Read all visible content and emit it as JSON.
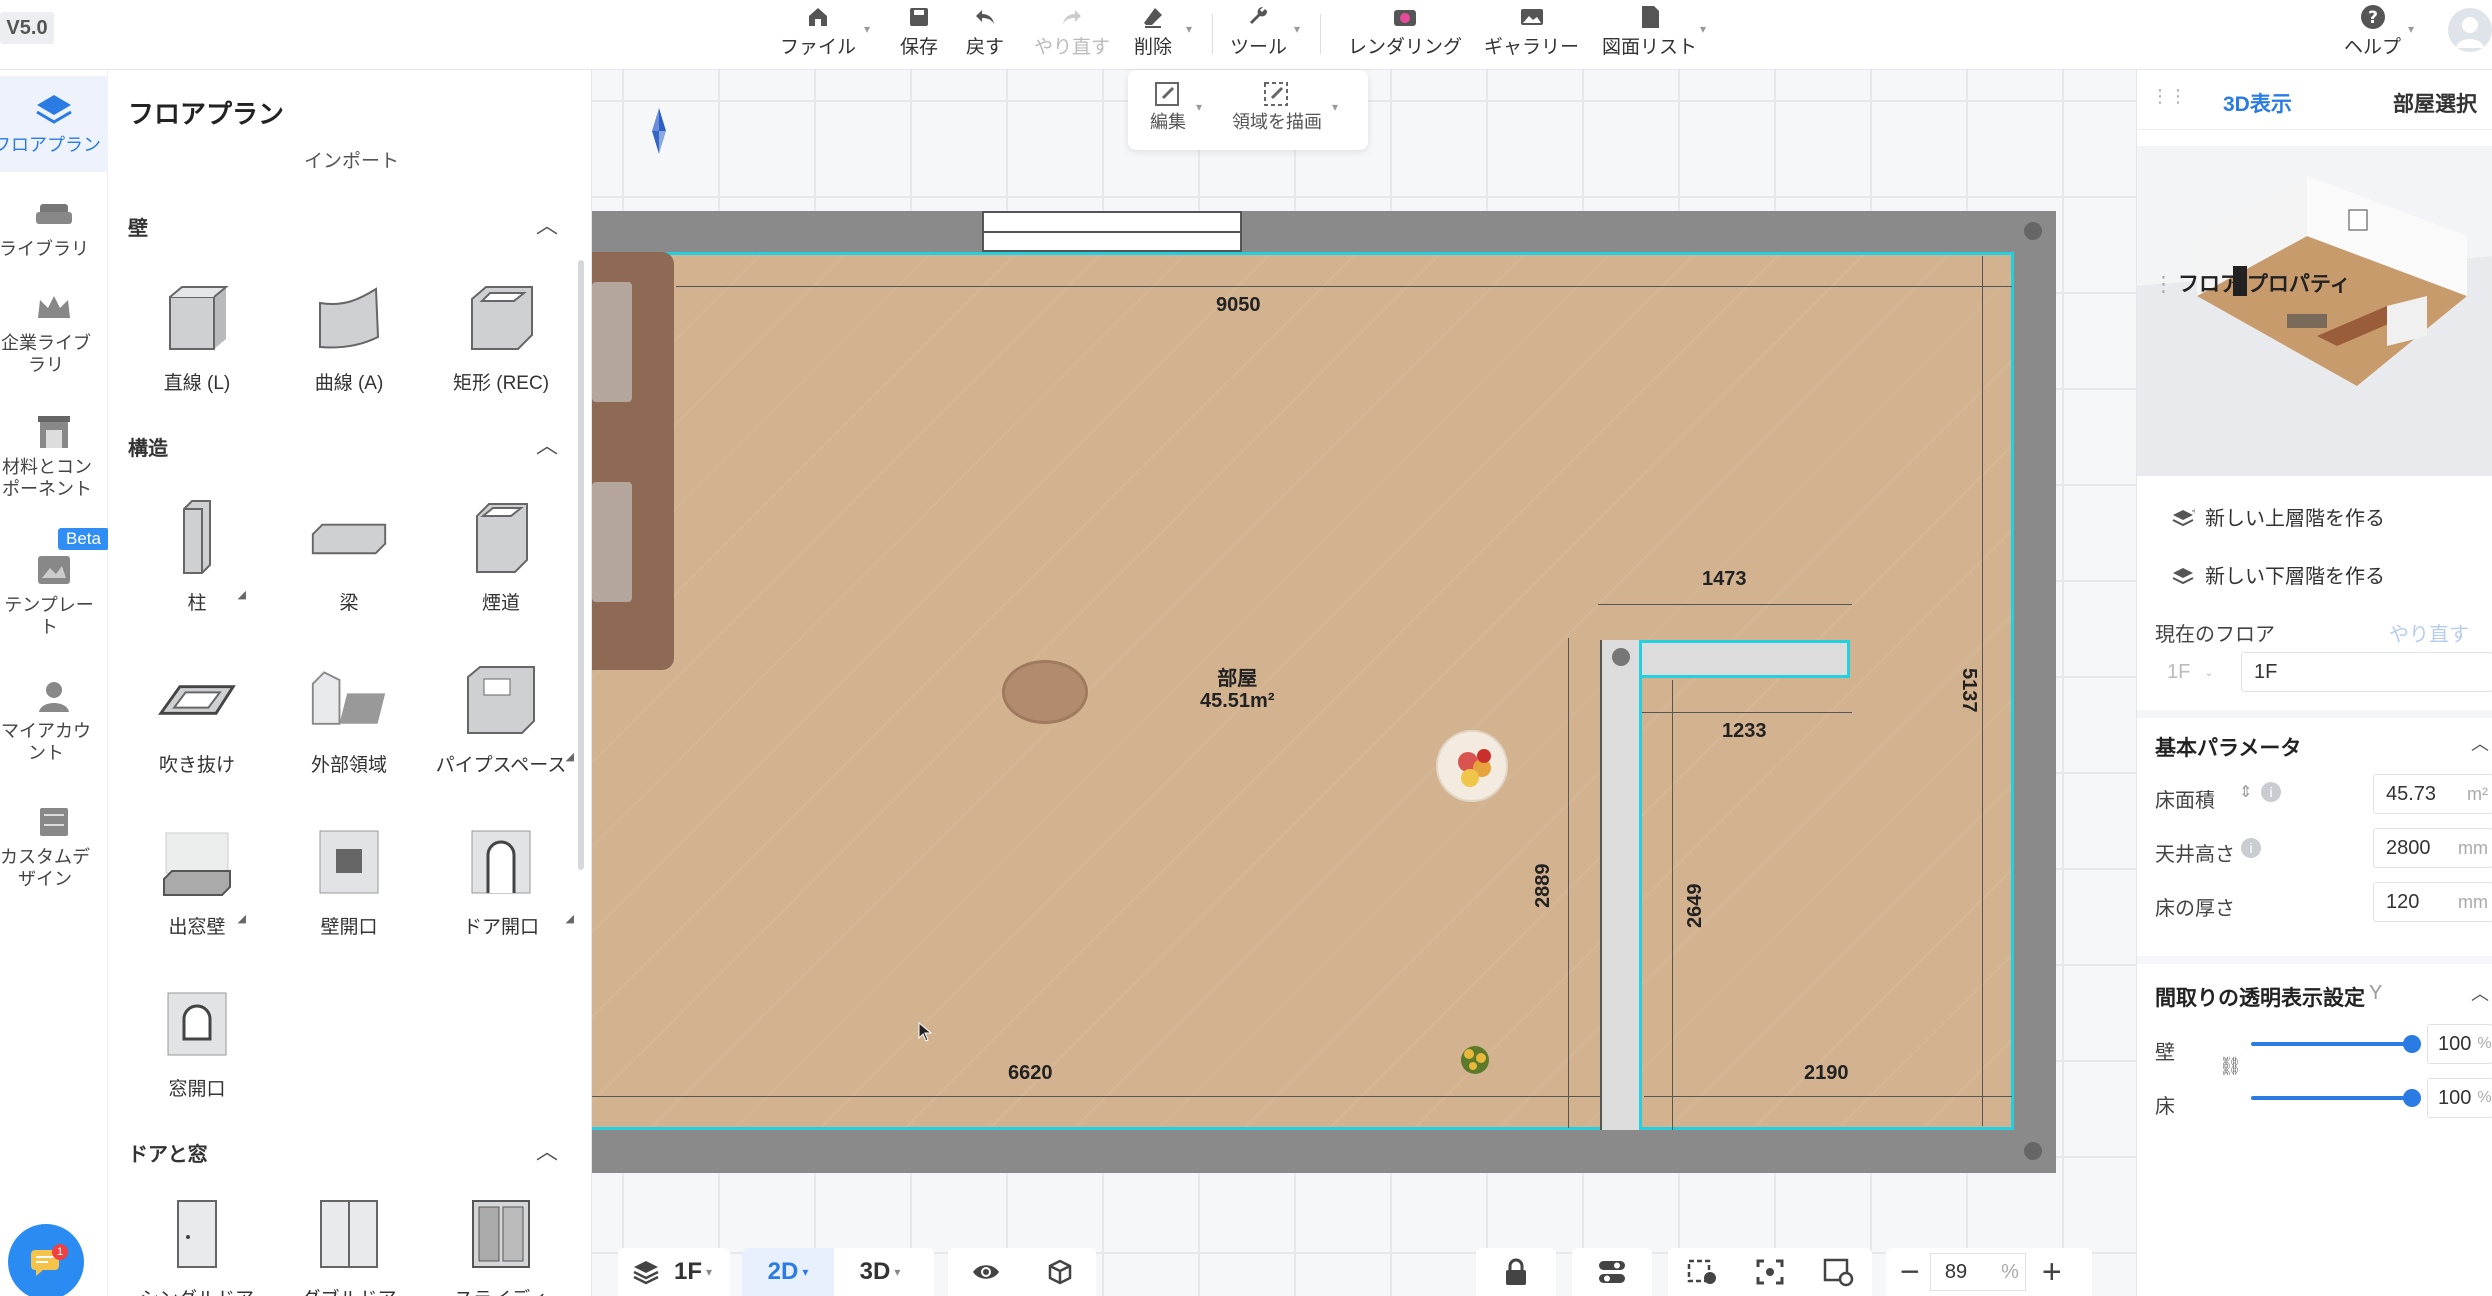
{
  "app": {
    "version": "V5.0"
  },
  "toolbar": {
    "file": "ファイル",
    "save": "保存",
    "undo": "戻す",
    "redo": "やり直す",
    "delete": "削除",
    "tools": "ツール",
    "render": "レンダリング",
    "gallery": "ギャラリー",
    "drawing_list": "図面リスト",
    "help": "ヘルプ"
  },
  "rail": {
    "items": [
      {
        "label": "フロアプラン",
        "icon": "floorplan-icon"
      },
      {
        "label": "ライブラリ",
        "icon": "sofa-icon"
      },
      {
        "label": "企業ライブラリ",
        "icon": "crown-icon"
      },
      {
        "label": "材料とコンポーネント",
        "icon": "fireplace-icon"
      },
      {
        "label": "テンプレート",
        "icon": "template-icon"
      },
      {
        "label": "マイアカウント",
        "icon": "user-icon"
      },
      {
        "label": "カスタムデザイン",
        "icon": "cabinet-icon"
      }
    ],
    "beta": "Beta",
    "chat_badge": "1"
  },
  "panel": {
    "title": "フロアプラン",
    "import": "インポート",
    "sections": {
      "wall": {
        "title": "壁",
        "items": [
          "直線 (L)",
          "曲線 (A)",
          "矩形 (REC)"
        ]
      },
      "structure": {
        "title": "構造",
        "items": [
          "柱",
          "梁",
          "煙道",
          "吹き抜け",
          "外部領域",
          "パイプスペース",
          "出窓壁",
          "壁開口",
          "ドア開口",
          "窓開口"
        ]
      },
      "door_window": {
        "title": "ドアと窓",
        "items": [
          "シングルドア",
          "ダブルドア",
          "スライディ"
        ]
      }
    }
  },
  "floating_tools": {
    "edit": "編集",
    "draw_area": "領域を描画"
  },
  "plan": {
    "room_name": "部屋",
    "room_area": "45.51m²",
    "dims": {
      "top": "9050",
      "l_top": "1473",
      "l_inner": "1233",
      "right": "5137",
      "l_left": "2889",
      "l_inner_v": "2649",
      "bottom_left": "6620",
      "bottom_right": "2190"
    }
  },
  "bottom_bar": {
    "floor": "1F",
    "view_2d": "2D",
    "view_3d": "3D",
    "zoom": "89",
    "zoom_unit": "%"
  },
  "right_panel": {
    "tab_3d": "3D表示",
    "tab_room": "部屋選択",
    "floor_props_title": "フロア プロパティ",
    "new_upper": "新しい上層階を作る",
    "new_lower": "新しい下層階を作る",
    "current_floor_label": "現在のフロア",
    "redo_link": "やり直す",
    "floor_code": "1F",
    "floor_name": "1F",
    "basic_params_title": "基本パラメータ",
    "floor_area_label": "床面積",
    "floor_area_value": "45.73",
    "floor_area_unit": "m²",
    "ceiling_label": "天井高さ",
    "ceiling_value": "2800",
    "ceiling_unit": "mm",
    "thickness_label": "床の厚さ",
    "thickness_value": "120",
    "thickness_unit": "mm",
    "transparency_title": "間取りの透明表示設定",
    "transparency_key": "Y",
    "wall_label": "壁",
    "wall_value": "100",
    "floor_label": "床",
    "floor_value": "100",
    "percent": "%",
    "colors": {
      "accent": "#2a7be4",
      "cyan_outline": "#23d0e0",
      "floor": "#d3b28f"
    }
  }
}
